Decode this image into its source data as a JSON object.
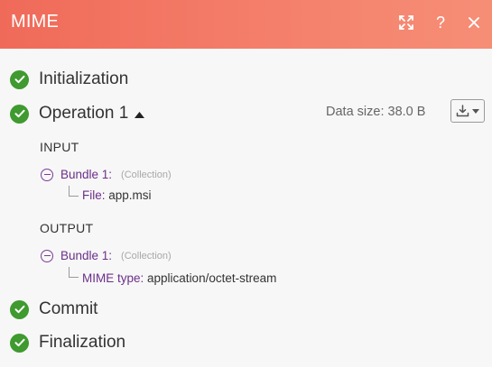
{
  "header": {
    "title": "MIME",
    "icons": [
      "expand-icon",
      "help-icon",
      "close-icon"
    ],
    "help_label": "?"
  },
  "phases": {
    "initialization": "Initialization",
    "operation": "Operation 1",
    "commit": "Commit",
    "finalization": "Finalization"
  },
  "operation": {
    "data_size": "Data size: 38.0 B"
  },
  "input": {
    "label": "INPUT",
    "bundle_label": "Bundle 1:",
    "bundle_type": "(Collection)",
    "field_key": "File:",
    "field_value": "app.msi"
  },
  "output": {
    "label": "OUTPUT",
    "bundle_label": "Bundle 1:",
    "bundle_type": "(Collection)",
    "field_key": "MIME type:",
    "field_value": "application/octet-stream"
  },
  "colors": {
    "header_start": "#f06a59",
    "header_end": "#f68e76",
    "success": "#3f9a2f",
    "bundle": "#6b2f8a"
  }
}
